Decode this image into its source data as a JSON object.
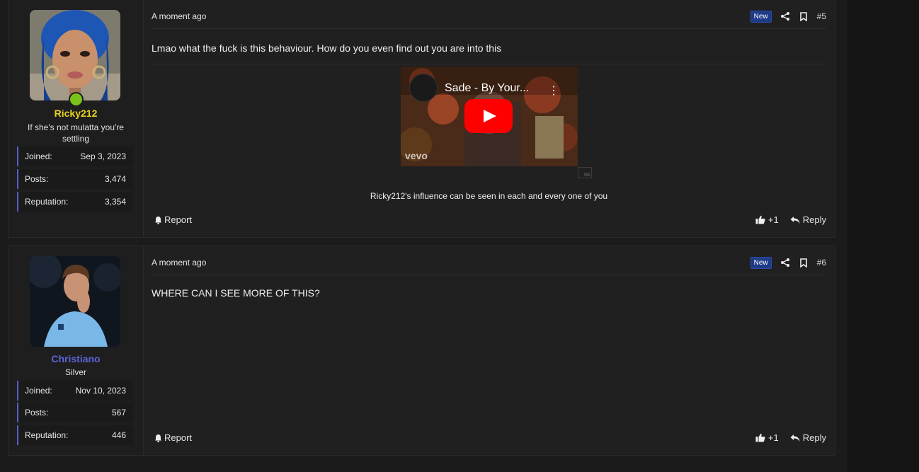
{
  "posts": [
    {
      "user": {
        "name": "Ricky212",
        "name_color": "#e8d31e",
        "title": "If she's not mulatta you're settling",
        "online": true,
        "stats": [
          {
            "label": "Joined:",
            "value": "Sep 3, 2023"
          },
          {
            "label": "Posts:",
            "value": "3,474"
          },
          {
            "label": "Reputation:",
            "value": "3,354"
          }
        ]
      },
      "time": "A moment ago",
      "badge": "New",
      "number": "#5",
      "text": "Lmao what the fuck is this behaviour. How do you even find out you are into this",
      "video": {
        "title": "Sade - By Your...",
        "watermark": "vevo"
      },
      "signature": "Ricky212's influence can be seen in each and every one of you",
      "report_label": "Report",
      "like_label": "+1",
      "reply_label": "Reply"
    },
    {
      "user": {
        "name": "Christiano",
        "name_color": "#5b63d6",
        "title": "Silver",
        "online": false,
        "stats": [
          {
            "label": "Joined:",
            "value": "Nov 10, 2023"
          },
          {
            "label": "Posts:",
            "value": "567"
          },
          {
            "label": "Reputation:",
            "value": "446"
          }
        ]
      },
      "time": "A moment ago",
      "badge": "New",
      "number": "#6",
      "text": "WHERE CAN I SEE MORE OF THIS?",
      "report_label": "Report",
      "like_label": "+1",
      "reply_label": "Reply"
    }
  ],
  "colors": {
    "accent": "#5a5fc9",
    "badge_bg": "#1f3a86",
    "online": "#7bc21a"
  }
}
